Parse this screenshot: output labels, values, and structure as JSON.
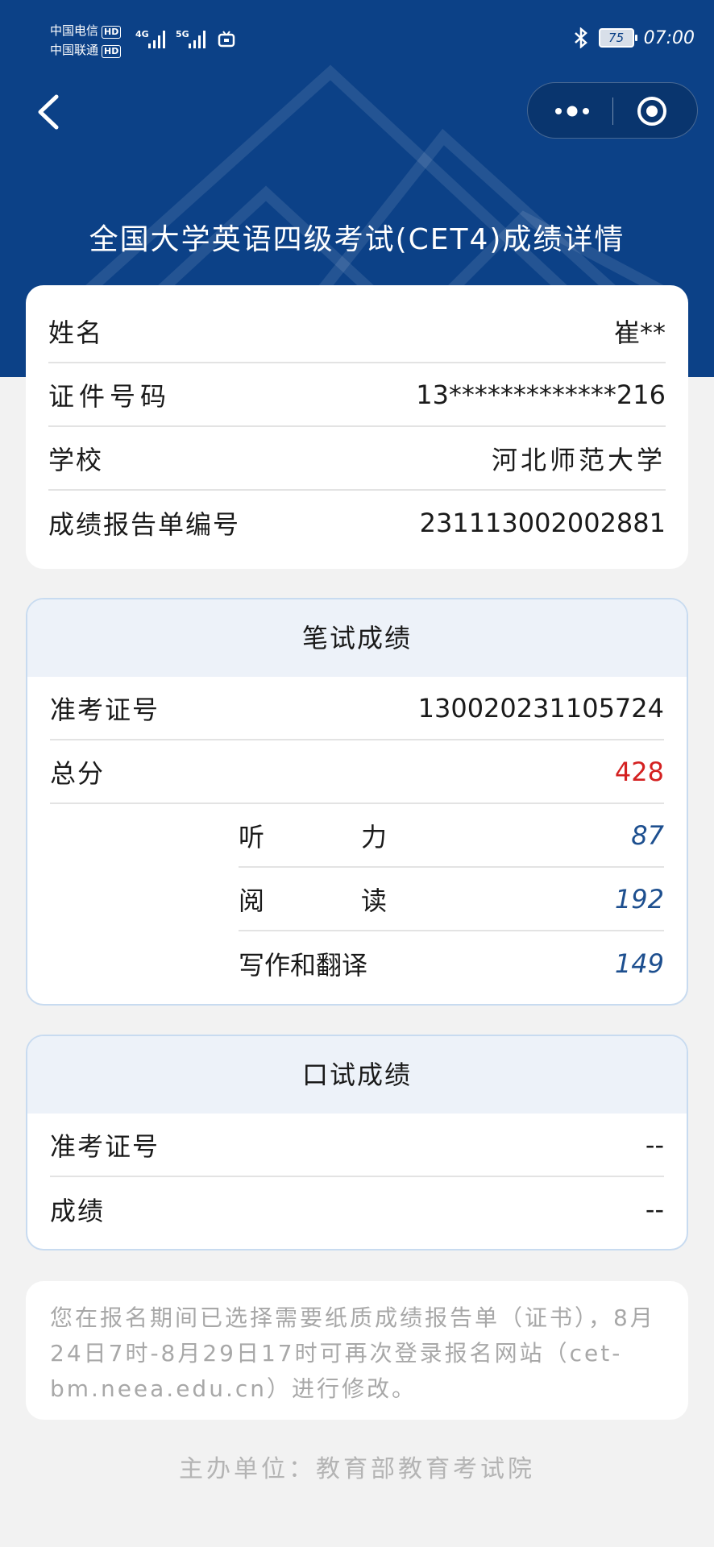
{
  "status_bar": {
    "carrier1": "中国电信",
    "carrier2": "中国联通",
    "hd": "HD",
    "net1": "4G",
    "net2": "5G",
    "battery": "75",
    "time": "07:00"
  },
  "header": {
    "title": "全国大学英语四级考试(CET4)成绩详情"
  },
  "info": {
    "rows": [
      {
        "label": "姓名",
        "value": "崔**"
      },
      {
        "label": "证件号码",
        "value": "13*************216"
      },
      {
        "label": "学校",
        "value": "河北师范大学"
      },
      {
        "label": "成绩报告单编号",
        "value": "231113002002881"
      }
    ]
  },
  "written": {
    "title": "笔试成绩",
    "ticket_label": "准考证号",
    "ticket_value": "130020231105724",
    "total_label": "总分",
    "total_value": "428",
    "subs": [
      {
        "label": "听力",
        "value": "87"
      },
      {
        "label": "阅读",
        "value": "192"
      },
      {
        "label": "写作和翻译",
        "value": "149"
      }
    ]
  },
  "oral": {
    "title": "口试成绩",
    "ticket_label": "准考证号",
    "ticket_value": "--",
    "score_label": "成绩",
    "score_value": "--"
  },
  "notice": "您在报名期间已选择需要纸质成绩报告单（证书），8月24日7时-8月29日17时可再次登录报名网站（cet-bm.neea.edu.cn）进行修改。",
  "footer": "主办单位：教育部教育考试院",
  "colors": {
    "header_bg": "#0c4187",
    "total_score": "#d42121",
    "sub_score": "#1d4f8f"
  }
}
